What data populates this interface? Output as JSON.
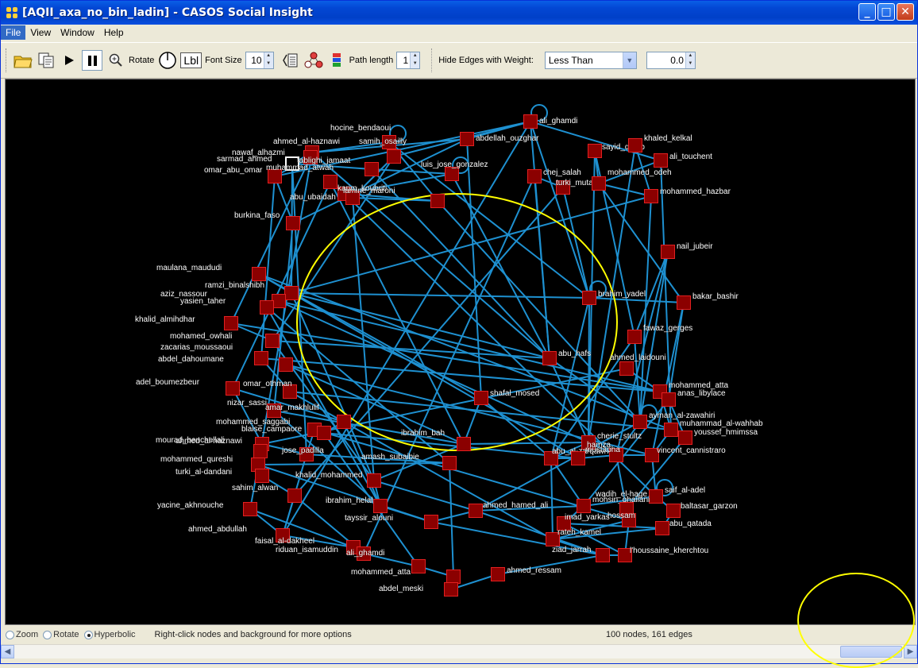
{
  "window": {
    "title": "[AQII_axa_no_bin_ladin] - CASOS Social Insight"
  },
  "menu": {
    "items": [
      "File",
      "View",
      "Window",
      "Help"
    ]
  },
  "toolbar": {
    "rotate_label": "Rotate",
    "lbl_label": "Lbl",
    "font_size_label": "Font Size",
    "font_size_value": "10",
    "path_length_label": "Path length",
    "path_length_value": "1",
    "hide_edges_label": "Hide Edges with Weight:",
    "condition_value": "Less Than",
    "weight_value": "0.0"
  },
  "status": {
    "zoom": "Zoom",
    "rotate": "Rotate",
    "hyperbolic": "Hyperbolic",
    "selected_mode": "Hyperbolic",
    "hint": "Right-click nodes and background for more options",
    "counts": "100 nodes, 161 edges"
  },
  "graph": {
    "edge_color": "#1e90d0",
    "node_fill": "#8b0000",
    "node_border": "#e32020",
    "nodes": [
      {
        "label": "ali_ghamdi"
      },
      {
        "label": "abdellah_ouzghar"
      },
      {
        "label": "hocine_bendaoui"
      },
      {
        "label": "ahmed_al-haznawi"
      },
      {
        "label": "nawaf_alhazmi"
      },
      {
        "label": "samih_osailly"
      },
      {
        "label": "sarmad_ahmed"
      },
      {
        "label": "omar_abu_omar"
      },
      {
        "label": "muhammad_atwah"
      },
      {
        "label": "tablighi_jamaat"
      },
      {
        "label": "luis_jose_gonzalez"
      },
      {
        "label": "karim_koubriti"
      },
      {
        "label": "abu_ubaidah"
      },
      {
        "label": "lamine_maroni"
      },
      {
        "label": "sayid_qutub"
      },
      {
        "label": "khaled_kelkal"
      },
      {
        "label": "ali_touchent"
      },
      {
        "label": "chej_salah"
      },
      {
        "label": "turki_mutairi"
      },
      {
        "label": "mohammed_odeh"
      },
      {
        "label": "mohammed_hazbar"
      },
      {
        "label": "burkina_faso"
      },
      {
        "label": "nail_jubeir"
      },
      {
        "label": "maulana_maududi"
      },
      {
        "label": "ramzi_binalshibh"
      },
      {
        "label": "aziz_nassour"
      },
      {
        "label": "yasien_taher"
      },
      {
        "label": "khalid_almihdhar"
      },
      {
        "label": "brahim_yadel"
      },
      {
        "label": "bakar_bashir"
      },
      {
        "label": "mohamed_owhali"
      },
      {
        "label": "fawaz_gerges"
      },
      {
        "label": "zacarias_moussaoui"
      },
      {
        "label": "abu_hafs"
      },
      {
        "label": "ahmed_laidouni"
      },
      {
        "label": "abdel_dahoumane"
      },
      {
        "label": "adel_boumezbeur"
      },
      {
        "label": "omar_othman"
      },
      {
        "label": "shafal_mosed"
      },
      {
        "label": "mohammed_atta"
      },
      {
        "label": "anas_libylace"
      },
      {
        "label": "nizar_sassi"
      },
      {
        "label": "amar_makhlulif"
      },
      {
        "label": "mohammed_saggabi"
      },
      {
        "label": "blaise_campaore"
      },
      {
        "label": "ayman_al-zawahiri"
      },
      {
        "label": "muhammad_al-wahhab"
      },
      {
        "label": "mourad_benchellali"
      },
      {
        "label": "ahmed_al-haznawi"
      },
      {
        "label": "ibrahim_bah"
      },
      {
        "label": "cherie_stultz"
      },
      {
        "label": "youssef_hmimssa"
      },
      {
        "label": "mohammed_qureshi"
      },
      {
        "label": "jose_padilla"
      },
      {
        "label": "amash_subaibie"
      },
      {
        "label": "abu_al-zarqawi"
      },
      {
        "label": "hamza"
      },
      {
        "label": "mustapha"
      },
      {
        "label": "vincent_cannistraro"
      },
      {
        "label": "turki_al-dandani"
      },
      {
        "label": "khalid_mohammed"
      },
      {
        "label": "saif_al-adel"
      },
      {
        "label": "sahim_alwan"
      },
      {
        "label": "ibrahim_helal"
      },
      {
        "label": "mohsin_ghailani"
      },
      {
        "label": "yacine_akhnouche"
      },
      {
        "label": "ahmed_hamed_ali"
      },
      {
        "label": "wadih_el-hage"
      },
      {
        "label": "baltasar_garzon"
      },
      {
        "label": "tayssir_alouni"
      },
      {
        "label": "hossam"
      },
      {
        "label": "imad_yarkas"
      },
      {
        "label": "abu_qatada"
      },
      {
        "label": "ahmed_abdullah"
      },
      {
        "label": "faisal_al-dakheel"
      },
      {
        "label": "rateh_kamel"
      },
      {
        "label": "riduan_isamuddin"
      },
      {
        "label": "l'houssaine_kherchtou"
      },
      {
        "label": "ali_ghamdi"
      },
      {
        "label": "ziad_jarrah"
      },
      {
        "label": "mohammed_atta"
      },
      {
        "label": "ahmed_ressam"
      },
      {
        "label": "abdel_meski"
      }
    ]
  }
}
